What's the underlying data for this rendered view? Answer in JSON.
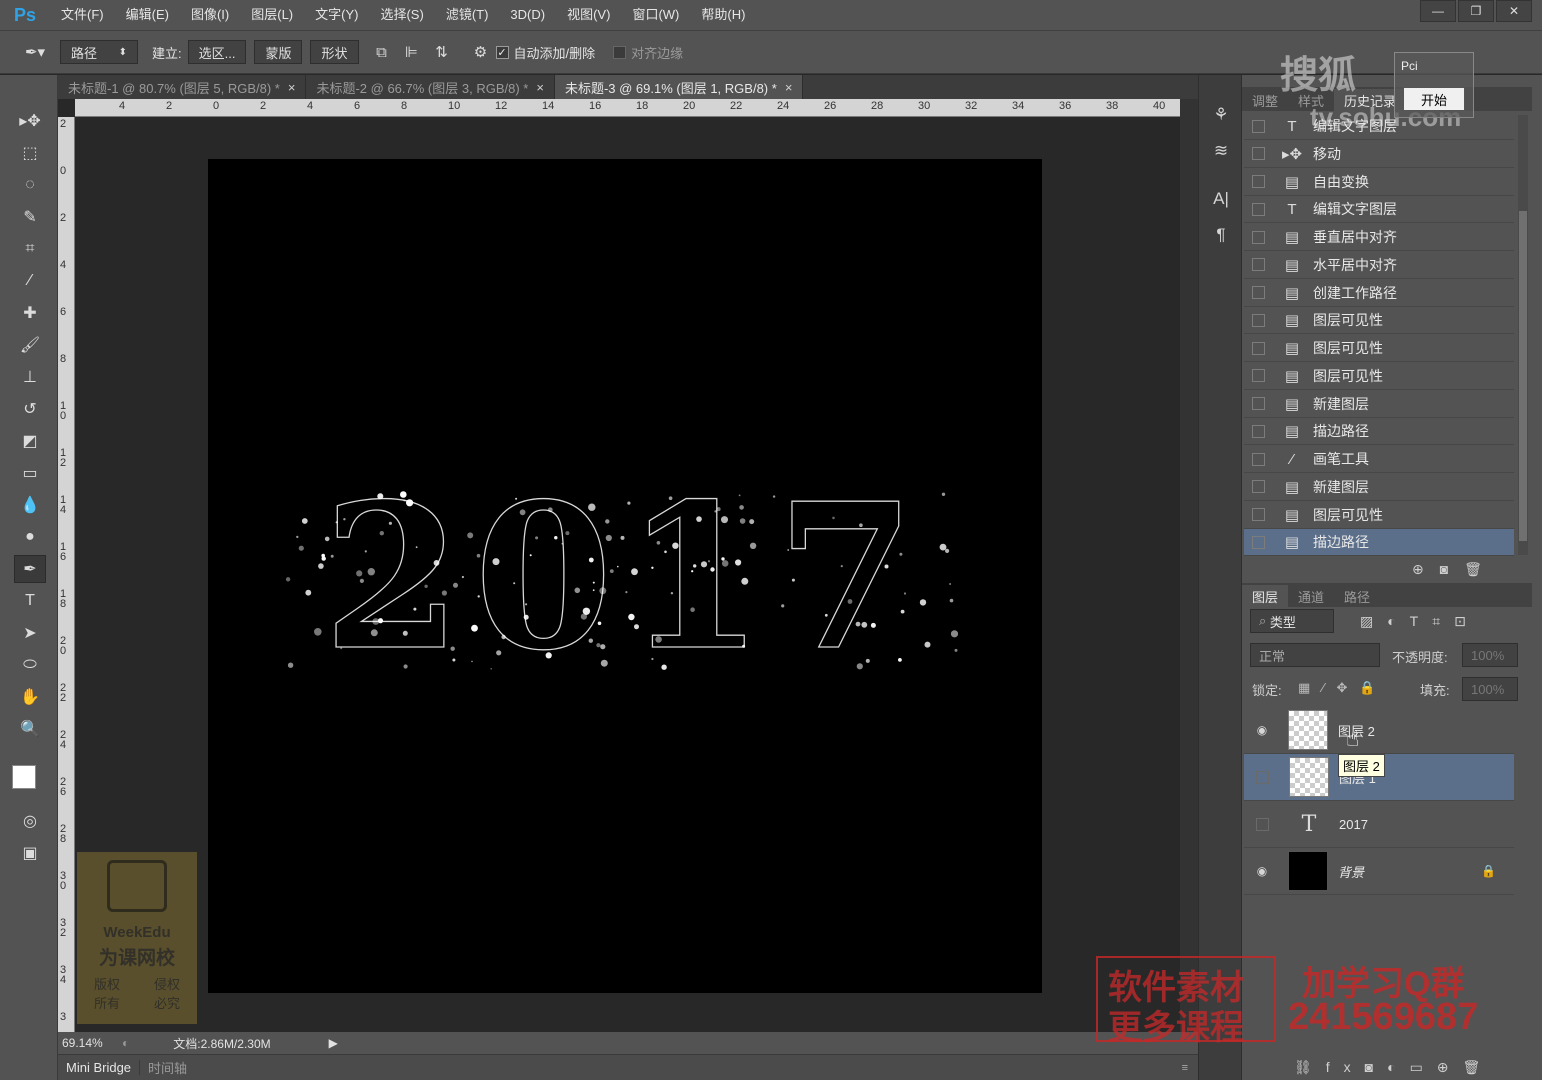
{
  "app": {
    "logo": "Ps"
  },
  "menu": [
    "文件(F)",
    "编辑(E)",
    "图像(I)",
    "图层(L)",
    "文字(Y)",
    "选择(S)",
    "滤镜(T)",
    "3D(D)",
    "视图(V)",
    "窗口(W)",
    "帮助(H)"
  ],
  "window_buttons": [
    "—",
    "❐",
    "✕"
  ],
  "options": {
    "mode": "路径",
    "build_label": "建立:",
    "selection_btn": "选区...",
    "mask_btn": "蒙版",
    "shape_btn": "形状",
    "auto_add_delete": "自动添加/删除",
    "align_edges": "对齐边缘"
  },
  "doc_tabs": [
    {
      "label": "未标题-1 @ 80.7% (图层 5, RGB/8) *",
      "close": "×",
      "active": false
    },
    {
      "label": "未标题-2 @ 66.7% (图层 3, RGB/8) *",
      "close": "×",
      "active": false
    },
    {
      "label": "未标题-3 @ 69.1% (图层 1, RGB/8) *",
      "close": "×",
      "active": true
    }
  ],
  "ruler_h": [
    "4",
    "2",
    "0",
    "2",
    "4",
    "6",
    "8",
    "10",
    "12",
    "14",
    "16",
    "18",
    "20",
    "22",
    "24",
    "26",
    "28",
    "30",
    "32",
    "34",
    "36",
    "38",
    "40"
  ],
  "ruler_v": [
    "2",
    "0",
    "2",
    "4",
    "6",
    "8",
    "10",
    "12",
    "14",
    "16",
    "18",
    "20",
    "22",
    "24",
    "26",
    "28",
    "30",
    "32",
    "34",
    "3"
  ],
  "canvas_text": "2017",
  "status": {
    "zoom": "69.14%",
    "doc": "文档:2.86M/2.30M"
  },
  "bottom_tabs": [
    "Mini Bridge",
    "时间轴"
  ],
  "history": {
    "tabs": [
      "调整",
      "样式",
      "历史记录"
    ],
    "items": [
      {
        "icon": "T",
        "label": "编辑文字图层"
      },
      {
        "icon": "move",
        "label": "移动"
      },
      {
        "icon": "doc",
        "label": "自由变换"
      },
      {
        "icon": "T",
        "label": "编辑文字图层"
      },
      {
        "icon": "doc",
        "label": "垂直居中对齐"
      },
      {
        "icon": "doc",
        "label": "水平居中对齐"
      },
      {
        "icon": "doc",
        "label": "创建工作路径"
      },
      {
        "icon": "doc",
        "label": "图层可见性"
      },
      {
        "icon": "doc",
        "label": "图层可见性"
      },
      {
        "icon": "doc",
        "label": "图层可见性"
      },
      {
        "icon": "doc",
        "label": "新建图层"
      },
      {
        "icon": "doc",
        "label": "描边路径"
      },
      {
        "icon": "brush",
        "label": "画笔工具"
      },
      {
        "icon": "doc",
        "label": "新建图层"
      },
      {
        "icon": "doc",
        "label": "图层可见性"
      },
      {
        "icon": "doc",
        "label": "描边路径",
        "selected": true
      }
    ]
  },
  "layers_panel": {
    "tabs": [
      "图层",
      "通道",
      "路径"
    ],
    "filter": "类型",
    "blend_mode": "正常",
    "opacity_label": "不透明度:",
    "opacity": "100%",
    "lock_label": "锁定:",
    "fill_label": "填充:",
    "fill": "100%",
    "layers": [
      {
        "name": "图层 2",
        "visible": true,
        "type": "pixel"
      },
      {
        "name": "图层 1",
        "visible": false,
        "type": "pixel",
        "selected": true
      },
      {
        "name": "2017",
        "visible": false,
        "type": "text"
      },
      {
        "name": "背景",
        "visible": true,
        "type": "background",
        "locked": true
      }
    ],
    "tooltip": "图层 2"
  },
  "overlays": {
    "sohu_line1": "搜狐",
    "sohu_line2": "tv.sohu.com",
    "pci_label": "Pci",
    "start_button": "开始",
    "weekedu": [
      "WeekEdu",
      "为课网校",
      "版权",
      "侵权",
      "所有",
      "必究"
    ],
    "promo1": "软件素材",
    "promo2": "更多课程",
    "promo3": "加学习Q群",
    "promo4": "241569687"
  }
}
